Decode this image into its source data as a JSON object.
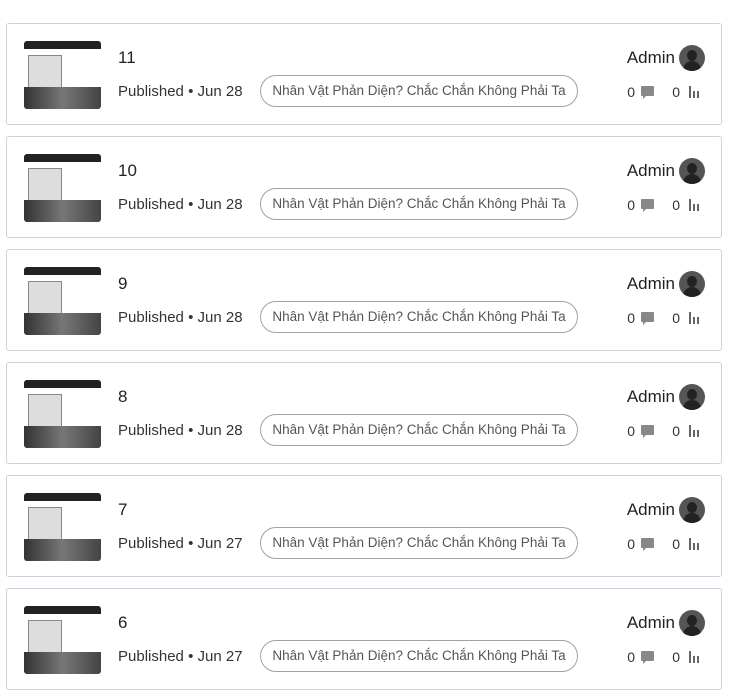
{
  "posts": [
    {
      "title": "11",
      "status": "Published",
      "date": "Jun 28",
      "series": "Nhân Vật Phản Diện? Chắc Chắn Không Phải Ta",
      "author": "Admin",
      "comments": "0",
      "views": "0"
    },
    {
      "title": "10",
      "status": "Published",
      "date": "Jun 28",
      "series": "Nhân Vật Phản Diện? Chắc Chắn Không Phải Ta",
      "author": "Admin",
      "comments": "0",
      "views": "0"
    },
    {
      "title": "9",
      "status": "Published",
      "date": "Jun 28",
      "series": "Nhân Vật Phản Diện? Chắc Chắn Không Phải Ta",
      "author": "Admin",
      "comments": "0",
      "views": "0"
    },
    {
      "title": "8",
      "status": "Published",
      "date": "Jun 28",
      "series": "Nhân Vật Phản Diện? Chắc Chắn Không Phải Ta",
      "author": "Admin",
      "comments": "0",
      "views": "0"
    },
    {
      "title": "7",
      "status": "Published",
      "date": "Jun 27",
      "series": "Nhân Vật Phản Diện? Chắc Chắn Không Phải Ta",
      "author": "Admin",
      "comments": "0",
      "views": "0"
    },
    {
      "title": "6",
      "status": "Published",
      "date": "Jun 27",
      "series": "Nhân Vật Phản Diện? Chắc Chắn Không Phải Ta",
      "author": "Admin",
      "comments": "0",
      "views": "0"
    }
  ],
  "separator": "•"
}
